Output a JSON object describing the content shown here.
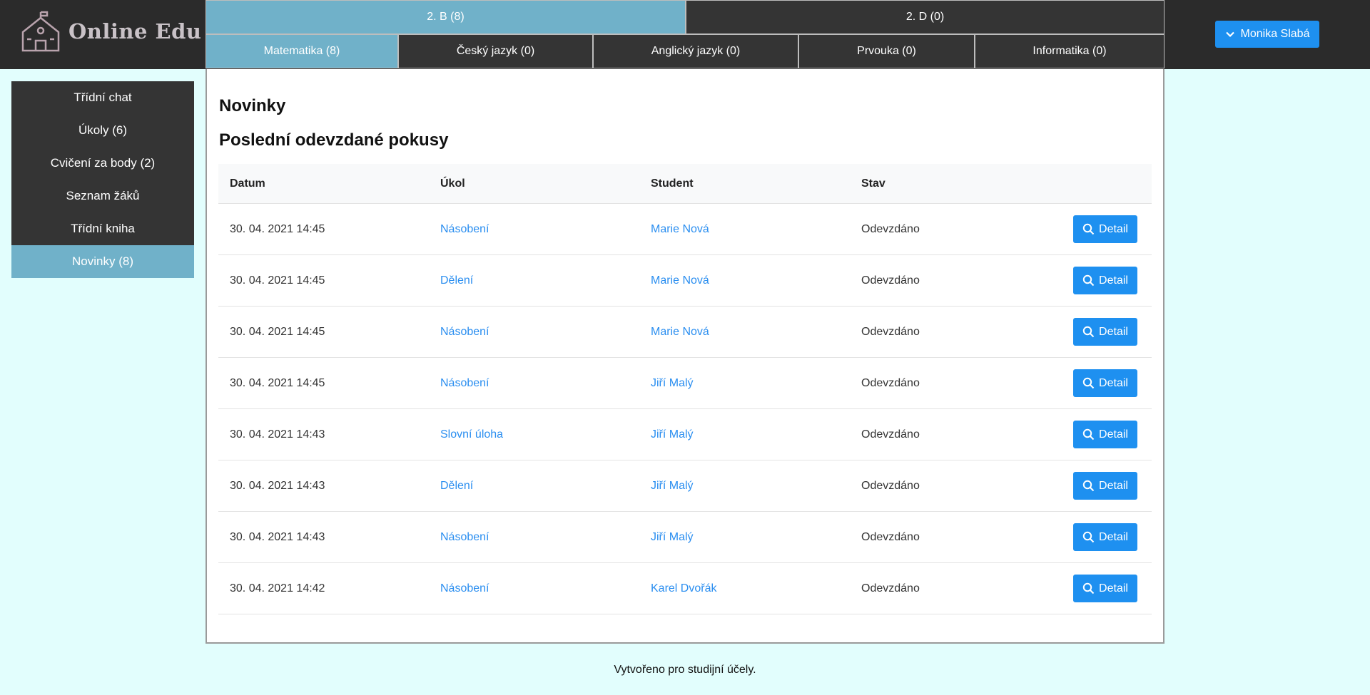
{
  "app": {
    "logo_text": "Online Edu"
  },
  "classes": [
    {
      "label": "2. B (8)",
      "active": true
    },
    {
      "label": "2. D (0)",
      "active": false
    }
  ],
  "subjects": [
    {
      "label": "Matematika (8)",
      "active": true
    },
    {
      "label": "Český jazyk (0)",
      "active": false
    },
    {
      "label": "Anglický jazyk (0)",
      "active": false
    },
    {
      "label": "Prvouka (0)",
      "active": false
    },
    {
      "label": "Informatika (0)",
      "active": false
    }
  ],
  "user": {
    "name": "Monika Slabá"
  },
  "sidebar": {
    "items": [
      {
        "label": "Třídní chat"
      },
      {
        "label": "Úkoly (6)"
      },
      {
        "label": "Cvičení za body (2)"
      },
      {
        "label": "Seznam žáků"
      },
      {
        "label": "Třídní kniha"
      },
      {
        "label": "Novinky (8)"
      }
    ]
  },
  "main": {
    "title": "Novinky",
    "subtitle": "Poslední odevzdané pokusy",
    "table": {
      "headers": {
        "date": "Datum",
        "task": "Úkol",
        "student": "Student",
        "status": "Stav"
      },
      "detail_label": "Detail",
      "rows": [
        {
          "date": "30. 04. 2021 14:45",
          "task": "Násobení",
          "student": "Marie Nová",
          "status": "Odevzdáno"
        },
        {
          "date": "30. 04. 2021 14:45",
          "task": "Dělení",
          "student": "Marie Nová",
          "status": "Odevzdáno"
        },
        {
          "date": "30. 04. 2021 14:45",
          "task": "Násobení",
          "student": "Marie Nová",
          "status": "Odevzdáno"
        },
        {
          "date": "30. 04. 2021 14:45",
          "task": "Násobení",
          "student": "Jiří Malý",
          "status": "Odevzdáno"
        },
        {
          "date": "30. 04. 2021 14:43",
          "task": "Slovní úloha",
          "student": "Jiří Malý",
          "status": "Odevzdáno"
        },
        {
          "date": "30. 04. 2021 14:43",
          "task": "Dělení",
          "student": "Jiří Malý",
          "status": "Odevzdáno"
        },
        {
          "date": "30. 04. 2021 14:43",
          "task": "Násobení",
          "student": "Jiří Malý",
          "status": "Odevzdáno"
        },
        {
          "date": "30. 04. 2021 14:42",
          "task": "Násobení",
          "student": "Karel Dvořák",
          "status": "Odevzdáno"
        }
      ]
    }
  },
  "footer": {
    "text": "Vytvořeno pro studijní účely."
  },
  "colors": {
    "header_bg": "#2b2b2b",
    "active_tab": "#70b1c9",
    "primary_button": "#1e90f0",
    "link": "#2a8ef0",
    "page_bg": "#e2fefd"
  }
}
